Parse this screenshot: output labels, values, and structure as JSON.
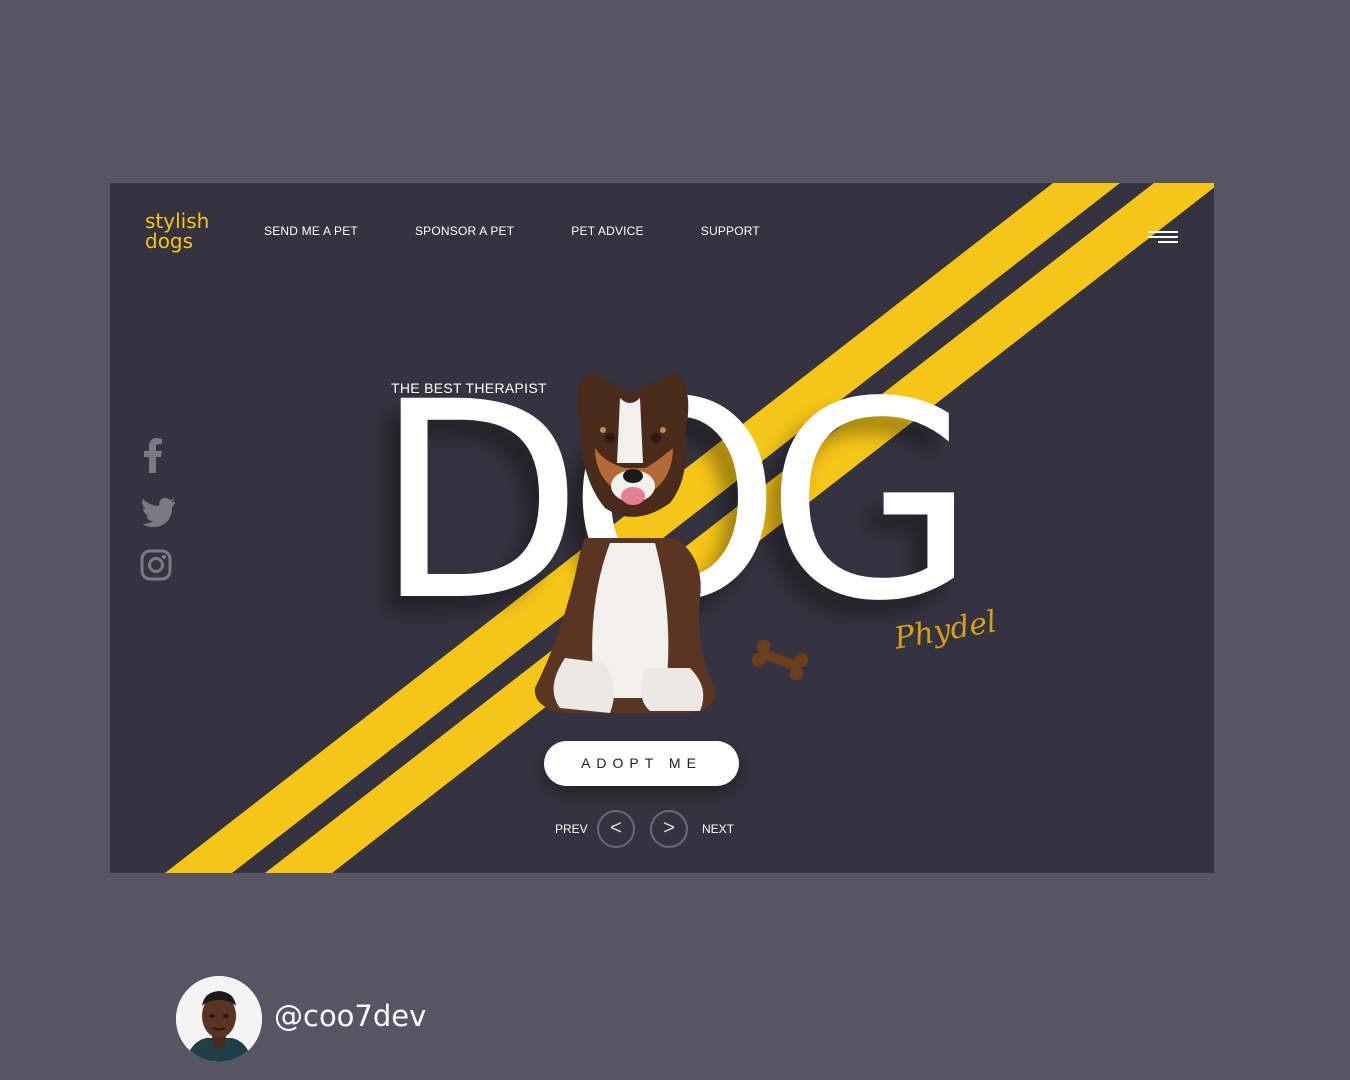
{
  "brand": {
    "line1": "stylish",
    "line2": "dogs",
    "accent": "#f5c518"
  },
  "nav": {
    "items": [
      {
        "label": "SEND ME A PET"
      },
      {
        "label": "SPONSOR A PET"
      },
      {
        "label": "PET ADVICE"
      },
      {
        "label": "SUPPORT"
      }
    ],
    "menu_icon": "hamburger-icon"
  },
  "social": [
    "facebook-icon",
    "twitter-icon",
    "instagram-icon"
  ],
  "hero": {
    "subtitle": "THE BEST THERAPIST",
    "title": "DOG",
    "signature": "Phydel"
  },
  "cta": {
    "adopt_label": "ADOPT ME"
  },
  "pager": {
    "prev_label": "PREV",
    "next_label": "NEXT",
    "prev_glyph": "<",
    "next_glyph": ">"
  },
  "author": {
    "handle": "@coo7dev"
  },
  "colors": {
    "background": "#575563",
    "card": "#34333f",
    "stripe": "#f5c518"
  }
}
